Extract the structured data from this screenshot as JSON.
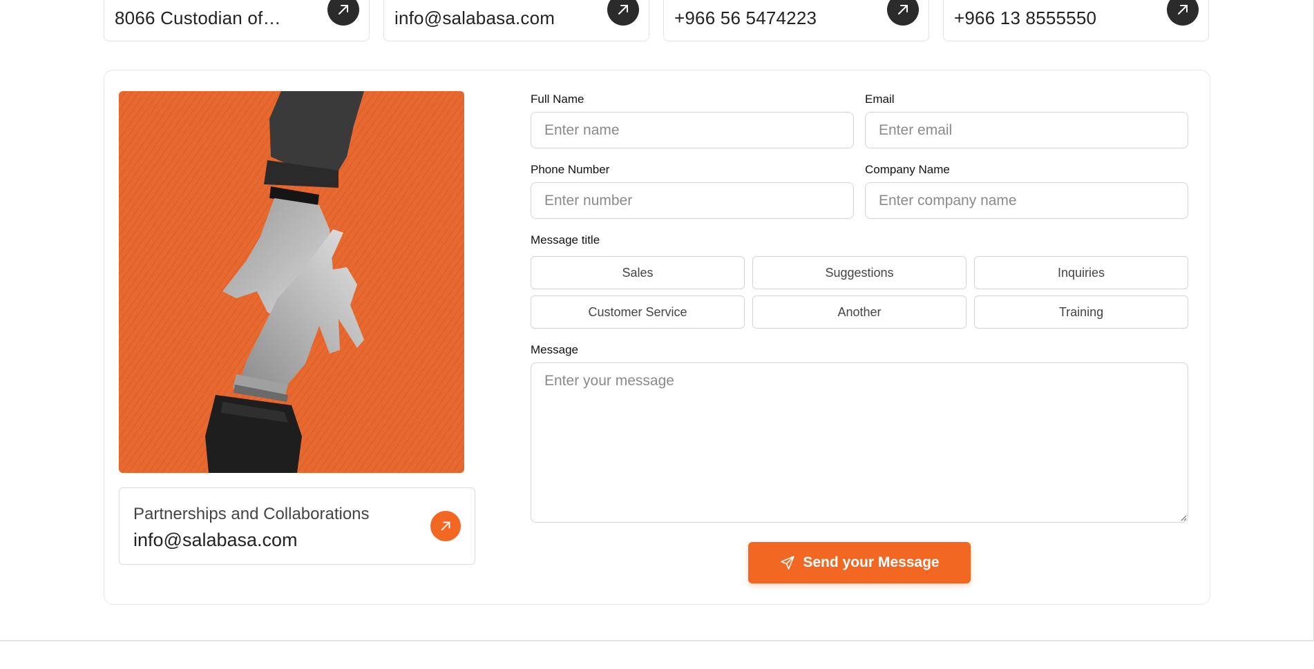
{
  "top_cards": [
    {
      "value": "8066 Custodian of…",
      "icon": "arrow-up-right-icon"
    },
    {
      "value": "info@salabasa.com",
      "icon": "arrow-up-right-icon"
    },
    {
      "value": "+966 56 5474223",
      "icon": "arrow-up-right-icon"
    },
    {
      "value": "+966 13 8555550",
      "icon": "arrow-up-right-icon"
    }
  ],
  "partner_card": {
    "label": "Partnerships and Collaborations",
    "value": "info@salabasa.com",
    "icon": "arrow-up-right-icon"
  },
  "form": {
    "full_name": {
      "label": "Full Name",
      "placeholder": "Enter name"
    },
    "email": {
      "label": "Email",
      "placeholder": "Enter email"
    },
    "phone": {
      "label": "Phone Number",
      "placeholder": "Enter number"
    },
    "company": {
      "label": "Company Name",
      "placeholder": "Enter company name"
    },
    "message_title": {
      "label": "Message title",
      "options": [
        "Sales",
        "Suggestions",
        "Inquiries",
        "Customer Service",
        "Another",
        "Training"
      ]
    },
    "message": {
      "label": "Message",
      "placeholder": "Enter your message"
    },
    "submit_label": "Send your Message",
    "submit_icon": "send-icon"
  },
  "colors": {
    "accent": "#f26722",
    "dark_button": "#2b2b2b",
    "border": "#d4d4d4"
  }
}
